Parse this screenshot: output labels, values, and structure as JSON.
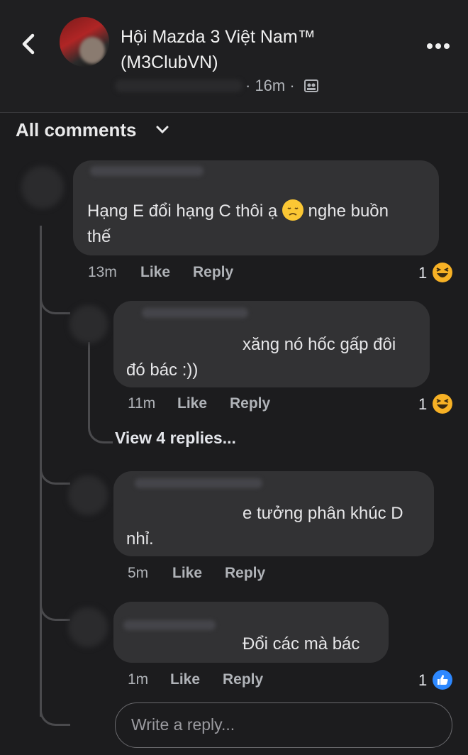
{
  "header": {
    "group_name": "Hội Mazda 3 Việt Nam™ (M3ClubVN)",
    "time": "· 16m ·",
    "privacy_icon": "group-members-icon",
    "more_icon": "more-horizontal-icon",
    "back_icon": "chevron-left-icon"
  },
  "filter": {
    "label": "All comments",
    "icon": "chevron-down-icon"
  },
  "comments": [
    {
      "text": "Hạng E đổi hạng C thôi ạ 😞 nghe buồn thế",
      "line1": "Hạng E đổi hạng C thôi ạ",
      "line1_emoji": "disappointed-face-emoji",
      "line1_end": "nghe buồn",
      "line2": "thế",
      "time": "13m",
      "like": "Like",
      "reply": "Reply",
      "reaction_count": "1",
      "reaction": "haha"
    },
    {
      "line1": "xăng nó hốc gấp đôi",
      "line2": "đó bác :))",
      "time": "11m",
      "like": "Like",
      "reply": "Reply",
      "reaction_count": "1",
      "reaction": "haha",
      "view_replies": "View 4 replies..."
    },
    {
      "line1": "e tưởng phân khúc D",
      "line2": "nhỉ.",
      "time": "5m",
      "like": "Like",
      "reply": "Reply"
    },
    {
      "line1": "Đổi các mà bác",
      "time": "1m",
      "like": "Like",
      "reply": "Reply",
      "reaction_count": "1",
      "reaction": "like"
    }
  ],
  "reply_box": {
    "placeholder": "Write a reply..."
  },
  "colors": {
    "background": "#1c1c1e",
    "bubble": "#323234",
    "like_blue": "#2d88ff",
    "haha_yellow": "#f7b125"
  }
}
